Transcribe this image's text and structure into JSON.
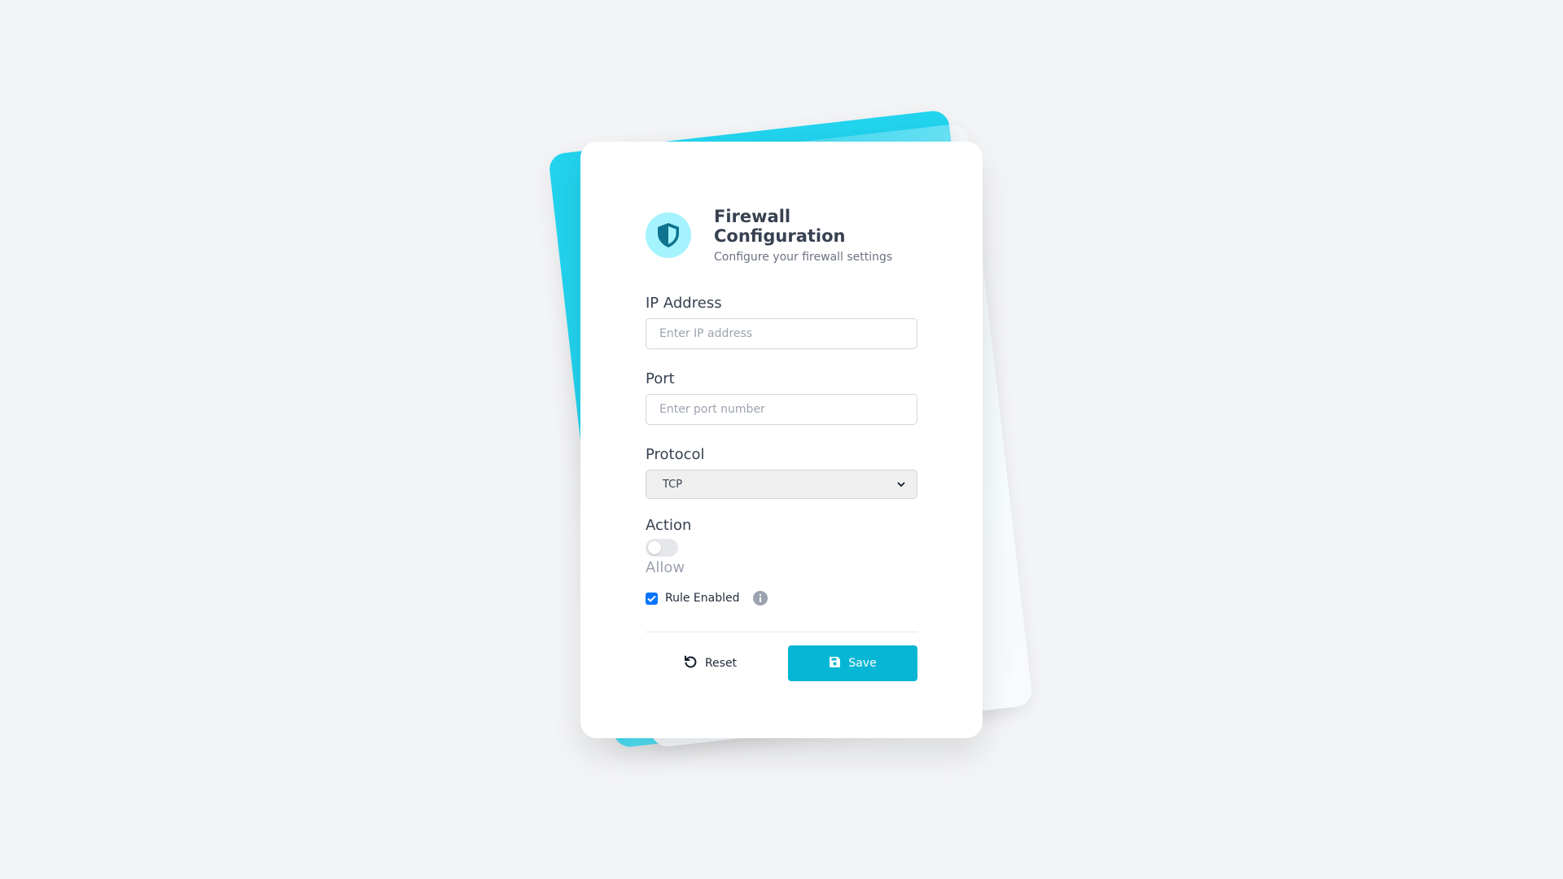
{
  "header": {
    "title": "Firewall Configuration",
    "subtitle": "Configure your firewall settings",
    "logo_icon": "shield-icon"
  },
  "form": {
    "ip": {
      "label": "IP Address",
      "value": "",
      "placeholder": "Enter IP address"
    },
    "port": {
      "label": "Port",
      "value": "",
      "placeholder": "Enter port number"
    },
    "protocol": {
      "label": "Protocol",
      "selected": "TCP"
    },
    "action": {
      "label": "Action",
      "toggle_on": false,
      "toggle_text": "Allow"
    },
    "rule_enabled": {
      "label": "Rule Enabled",
      "checked": true,
      "info_icon": "info-icon"
    }
  },
  "buttons": {
    "reset_label": "Reset",
    "reset_icon": "undo-icon",
    "save_label": "Save",
    "save_icon": "floppy-disk-icon"
  },
  "colors": {
    "accent": "#06b6d4",
    "accent_light": "#a5f3fc",
    "checkbox": "#0075ff",
    "background": "#f3f4f6"
  }
}
